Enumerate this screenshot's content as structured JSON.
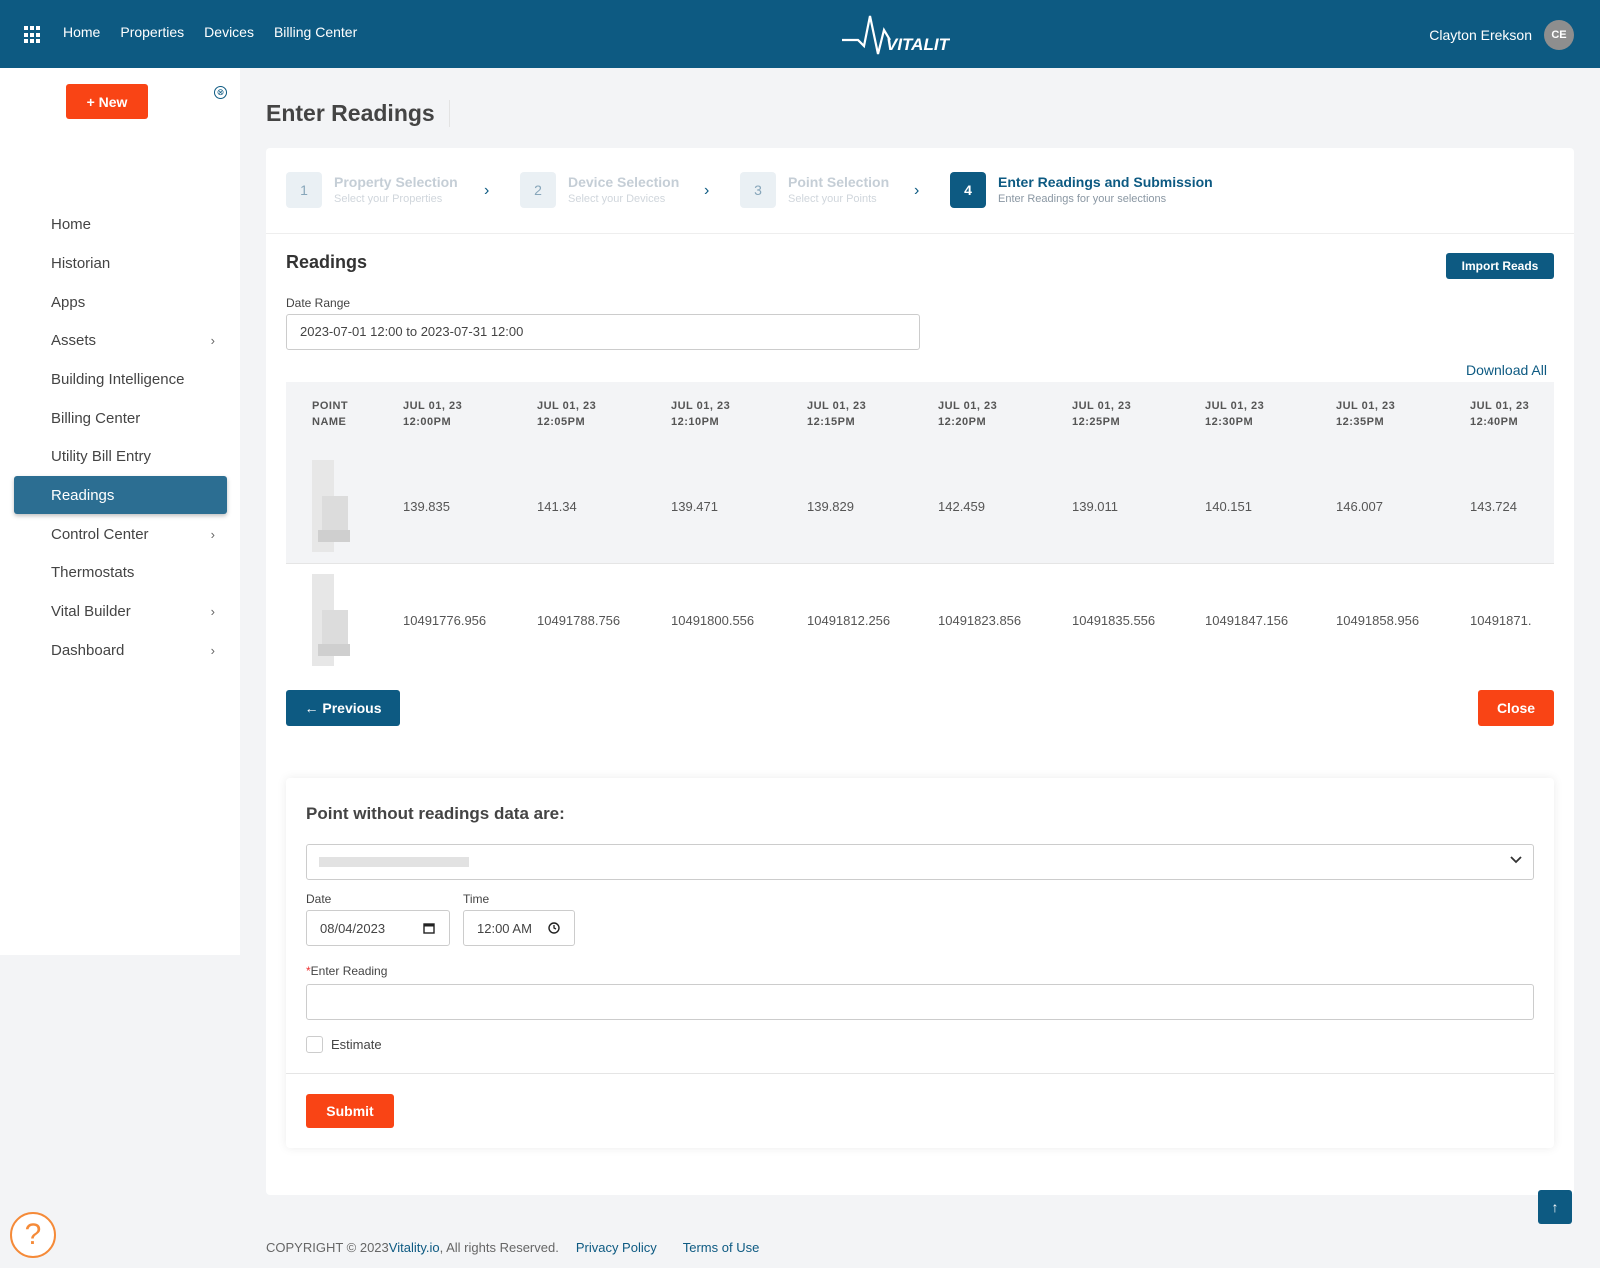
{
  "topbar": {
    "nav": [
      "Home",
      "Properties",
      "Devices",
      "Billing Center"
    ],
    "logo_text": "VITALITY",
    "user_name": "Clayton Erekson",
    "user_initials": "CE",
    "brand_color": "#0d5a82"
  },
  "sidebar": {
    "new_label": "+ New",
    "items": [
      {
        "label": "Home",
        "has_chevron": false
      },
      {
        "label": "Historian",
        "has_chevron": false
      },
      {
        "label": "Apps",
        "has_chevron": false
      },
      {
        "label": "Assets",
        "has_chevron": true
      },
      {
        "label": "Building Intelligence",
        "has_chevron": false
      },
      {
        "label": "Billing Center",
        "has_chevron": false
      },
      {
        "label": "Utility Bill Entry",
        "has_chevron": false
      },
      {
        "label": "Readings",
        "has_chevron": false,
        "active": true
      },
      {
        "label": "Control Center",
        "has_chevron": true
      },
      {
        "label": "Thermostats",
        "has_chevron": false
      },
      {
        "label": "Vital Builder",
        "has_chevron": true
      },
      {
        "label": "Dashboard",
        "has_chevron": true
      }
    ]
  },
  "page": {
    "title": "Enter Readings"
  },
  "stepper": [
    {
      "num": "1",
      "title": "Property Selection",
      "sub": "Select your Properties"
    },
    {
      "num": "2",
      "title": "Device Selection",
      "sub": "Select your Devices"
    },
    {
      "num": "3",
      "title": "Point Selection",
      "sub": "Select your Points"
    },
    {
      "num": "4",
      "title": "Enter Readings and Submission",
      "sub": "Enter Readings for your selections"
    }
  ],
  "readings": {
    "title": "Readings",
    "import_label": "Import Reads",
    "date_range_label": "Date Range",
    "date_range_value": "2023-07-01 12:00 to 2023-07-31 12:00",
    "download_all": "Download All",
    "columns": [
      "POINT\nNAME",
      "JUL 01, 23\n12:00PM",
      "JUL 01, 23\n12:05PM",
      "JUL 01, 23\n12:10PM",
      "JUL 01, 23\n12:15PM",
      "JUL 01, 23\n12:20PM",
      "JUL 01, 23\n12:25PM",
      "JUL 01, 23\n12:30PM",
      "JUL 01, 23\n12:35PM",
      "JUL 01, 23\n12:40PM"
    ],
    "rows": [
      [
        "139.835",
        "141.34",
        "139.471",
        "139.829",
        "142.459",
        "139.011",
        "140.151",
        "146.007",
        "143.724"
      ],
      [
        "10491776.956",
        "10491788.756",
        "10491800.556",
        "10491812.256",
        "10491823.856",
        "10491835.556",
        "10491847.156",
        "10491858.956",
        "10491871."
      ]
    ],
    "previous_label": "← Previous",
    "close_label": "Close"
  },
  "entry": {
    "title": "Point without readings data are:",
    "date_label": "Date",
    "date_value": "08/04/2023",
    "time_label": "Time",
    "time_value": "12:00 AM",
    "reading_label": "Enter Reading",
    "estimate_label": "Estimate",
    "submit_label": "Submit"
  },
  "footer": {
    "copyright": "COPYRIGHT © 2023 ",
    "site_link": "Vitality.io",
    "rights": ", All rights Reserved.",
    "privacy": "Privacy Policy",
    "terms": "Terms of Use"
  }
}
